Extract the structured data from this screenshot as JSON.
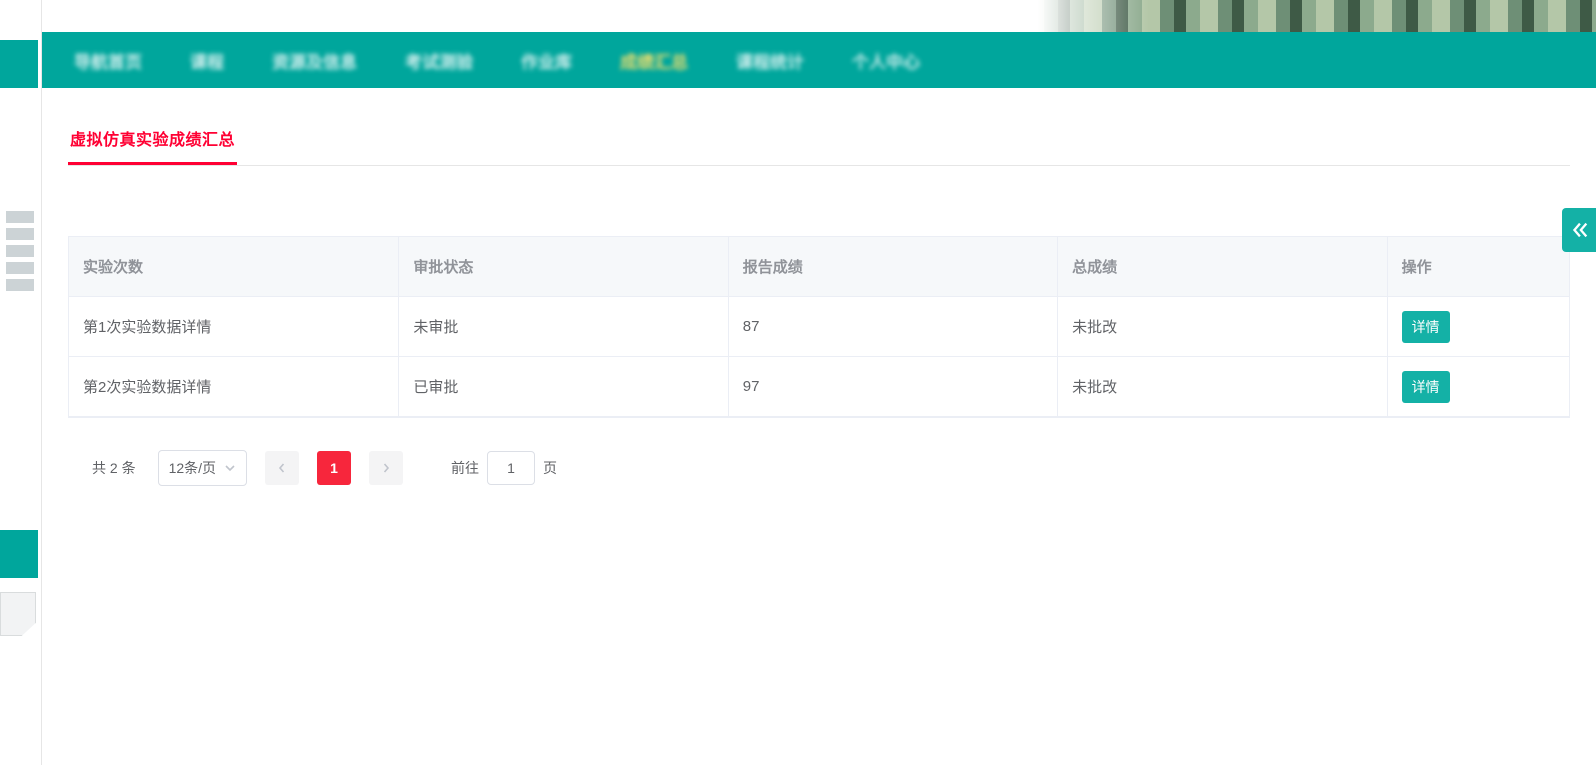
{
  "nav": {
    "items": [
      "导航首页",
      "课程",
      "资源及信息",
      "考试测验",
      "作业库",
      "成绩汇总",
      "课程统计",
      "个人中心"
    ],
    "active_index": 5
  },
  "page": {
    "tab_title": "虚拟仿真实验成绩汇总"
  },
  "table": {
    "headers": {
      "experiment_count": "实验次数",
      "approval_status": "审批状态",
      "report_score": "报告成绩",
      "total_score": "总成绩",
      "operation": "操作"
    },
    "rows": [
      {
        "experiment_count": "第1次实验数据详情",
        "approval_status": "未审批",
        "report_score": "87",
        "total_score": "未批改",
        "operation_label": "详情"
      },
      {
        "experiment_count": "第2次实验数据详情",
        "approval_status": "已审批",
        "report_score": "97",
        "total_score": "未批改",
        "operation_label": "详情"
      }
    ]
  },
  "pagination": {
    "total_text": "共 2 条",
    "page_size_label": "12条/页",
    "current_page": "1",
    "goto_prefix": "前往",
    "goto_value": "1",
    "goto_suffix": "页"
  }
}
